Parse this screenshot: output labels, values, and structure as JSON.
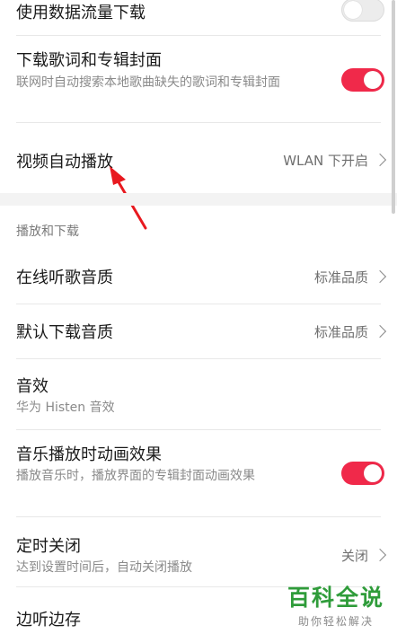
{
  "settings": {
    "mobile_data_download": {
      "label": "使用数据流量下载",
      "enabled": false
    },
    "lyrics_cover_download": {
      "label": "下载歌词和专辑封面",
      "description": "联网时自动搜索本地歌曲缺失的歌词和专辑封面",
      "enabled": true
    },
    "video_autoplay": {
      "label": "视频自动播放",
      "value": "WLAN 下开启"
    }
  },
  "playback_section": {
    "header": "播放和下载",
    "online_quality": {
      "label": "在线听歌音质",
      "value": "标准品质"
    },
    "download_quality": {
      "label": "默认下载音质",
      "value": "标准品质"
    },
    "sound_effect": {
      "label": "音效",
      "description": "华为 Histen 音效"
    },
    "animation_effect": {
      "label": "音乐播放时动画效果",
      "description": "播放音乐时，播放界面的专辑封面动画效果",
      "enabled": true
    },
    "sleep_timer": {
      "label": "定时关闭",
      "description": "达到设置时间后，自动关闭播放",
      "value": "关闭"
    },
    "cache_while_playing": {
      "label": "边听边存"
    }
  },
  "watermark": {
    "title": "百科全说",
    "subtitle": "助你轻松解决"
  },
  "colors": {
    "accent": "#f0294a",
    "annotation_arrow": "#e8191f",
    "watermark": "#2f9c3a"
  }
}
